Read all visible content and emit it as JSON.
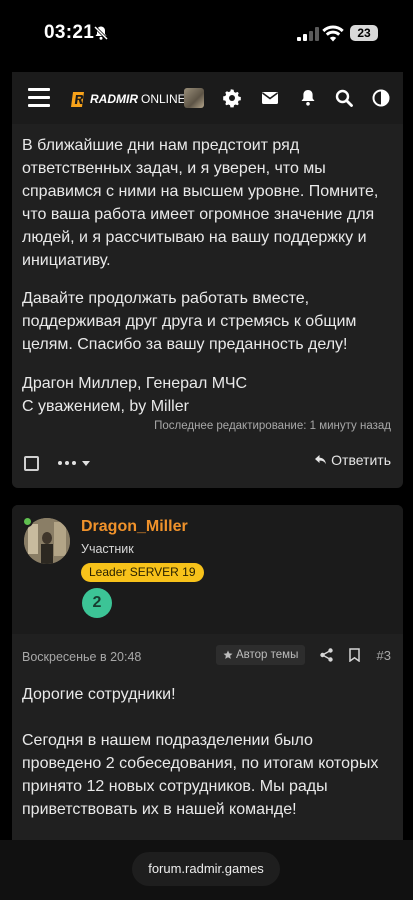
{
  "status_bar": {
    "time": "03:21",
    "battery": "23"
  },
  "header": {
    "logo_bold": "RADMIR",
    "logo_light": "ONLINE",
    "icons": [
      "menu-icon",
      "user-avatar",
      "gear-icon",
      "envelope-icon",
      "bell-icon",
      "search-icon",
      "theme-toggle-icon"
    ]
  },
  "post1": {
    "paragraph1": "В ближайшие дни нам предстоит ряд ответственных задач, и я уверен, что мы справимся с ними на высшем уровне. Помните, что ваша работа имеет огромное значение для людей, и я рассчитываю на вашу поддержку и инициативу.",
    "paragraph2": "Давайте продолжать работать вместе, поддерживая друг друга и стремясь к общим целям. Спасибо за вашу преданность делу!",
    "signature_line1": "Драгон Миллер, Генерал МЧС",
    "signature_line2": "С уважением, by Miller",
    "edit_note": "Последнее редактирование: 1 минуту назад",
    "reply_label": "Ответить"
  },
  "post2": {
    "username": "Dragon_Miller",
    "user_title": "Участник",
    "badge": "Leader SERVER 19",
    "level": "2",
    "date": "Воскресенье в 20:48",
    "author_tag": "Автор темы",
    "number": "#3",
    "greeting": "Дорогие сотрудники!",
    "paragraph1": "Сегодня в нашем подразделении было проведено 2 собеседования, по итогам которых принято 12 новых сотрудников. Мы рады приветствовать их в нашей команде!"
  },
  "browser": {
    "url": "forum.radmir.games"
  },
  "colors": {
    "accent_orange": "#f0922b",
    "badge_yellow": "#f7c21a",
    "level_green": "#3cc496",
    "online_green": "#5fbf4f"
  }
}
